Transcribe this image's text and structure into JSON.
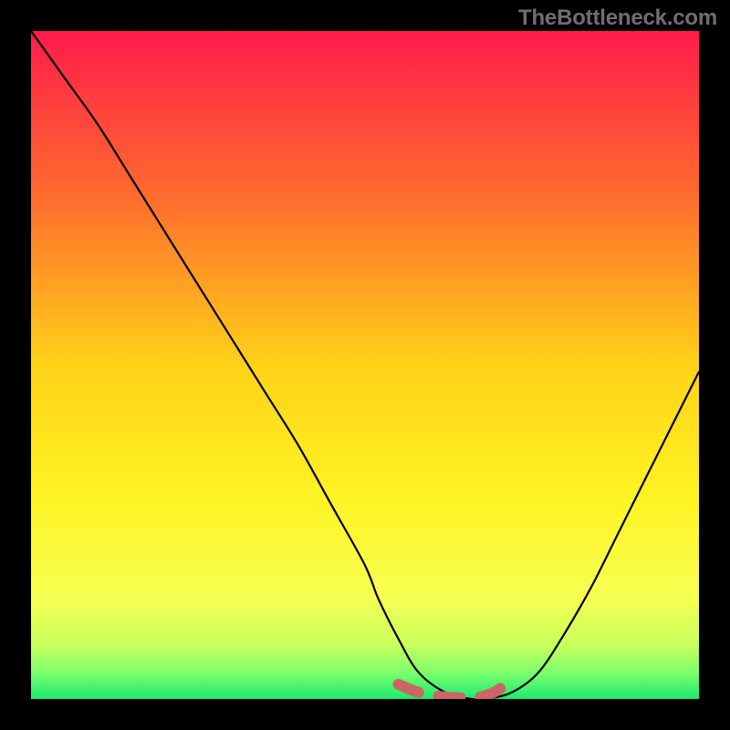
{
  "watermark": "TheBottleneck.com",
  "chart_data": {
    "type": "line",
    "title": "",
    "xlabel": "",
    "ylabel": "",
    "xlim": [
      0,
      100
    ],
    "ylim": [
      0,
      100
    ],
    "gradient_stops": [
      {
        "offset": 0.0,
        "color": "#ff1b4b"
      },
      {
        "offset": 0.25,
        "color": "#ff6d2e"
      },
      {
        "offset": 0.5,
        "color": "#ffd218"
      },
      {
        "offset": 0.7,
        "color": "#fff423"
      },
      {
        "offset": 0.85,
        "color": "#f6ff52"
      },
      {
        "offset": 0.92,
        "color": "#c8ff5d"
      },
      {
        "offset": 0.96,
        "color": "#7dff6d"
      },
      {
        "offset": 1.0,
        "color": "#1cea6e"
      }
    ],
    "series": [
      {
        "name": "bottleneck-curve",
        "x": [
          0,
          5,
          10,
          15,
          20,
          25,
          30,
          35,
          40,
          45,
          50,
          52,
          55,
          58,
          62,
          66,
          68,
          72,
          76,
          80,
          84,
          88,
          92,
          96,
          100
        ],
        "y": [
          100,
          93,
          86,
          78,
          70,
          62,
          54,
          46,
          38,
          29,
          20,
          15,
          9,
          4,
          1,
          0,
          0,
          1,
          4,
          10,
          17,
          25,
          33,
          41,
          49
        ]
      },
      {
        "name": "optimal-range-highlight",
        "x": [
          55,
          58,
          62,
          66,
          68,
          70,
          72
        ],
        "y": [
          2.2,
          1.0,
          0.3,
          0.2,
          0.5,
          1.4,
          3.2
        ]
      }
    ],
    "highlight_color": "#cc6666",
    "curve_color": "#000000"
  }
}
